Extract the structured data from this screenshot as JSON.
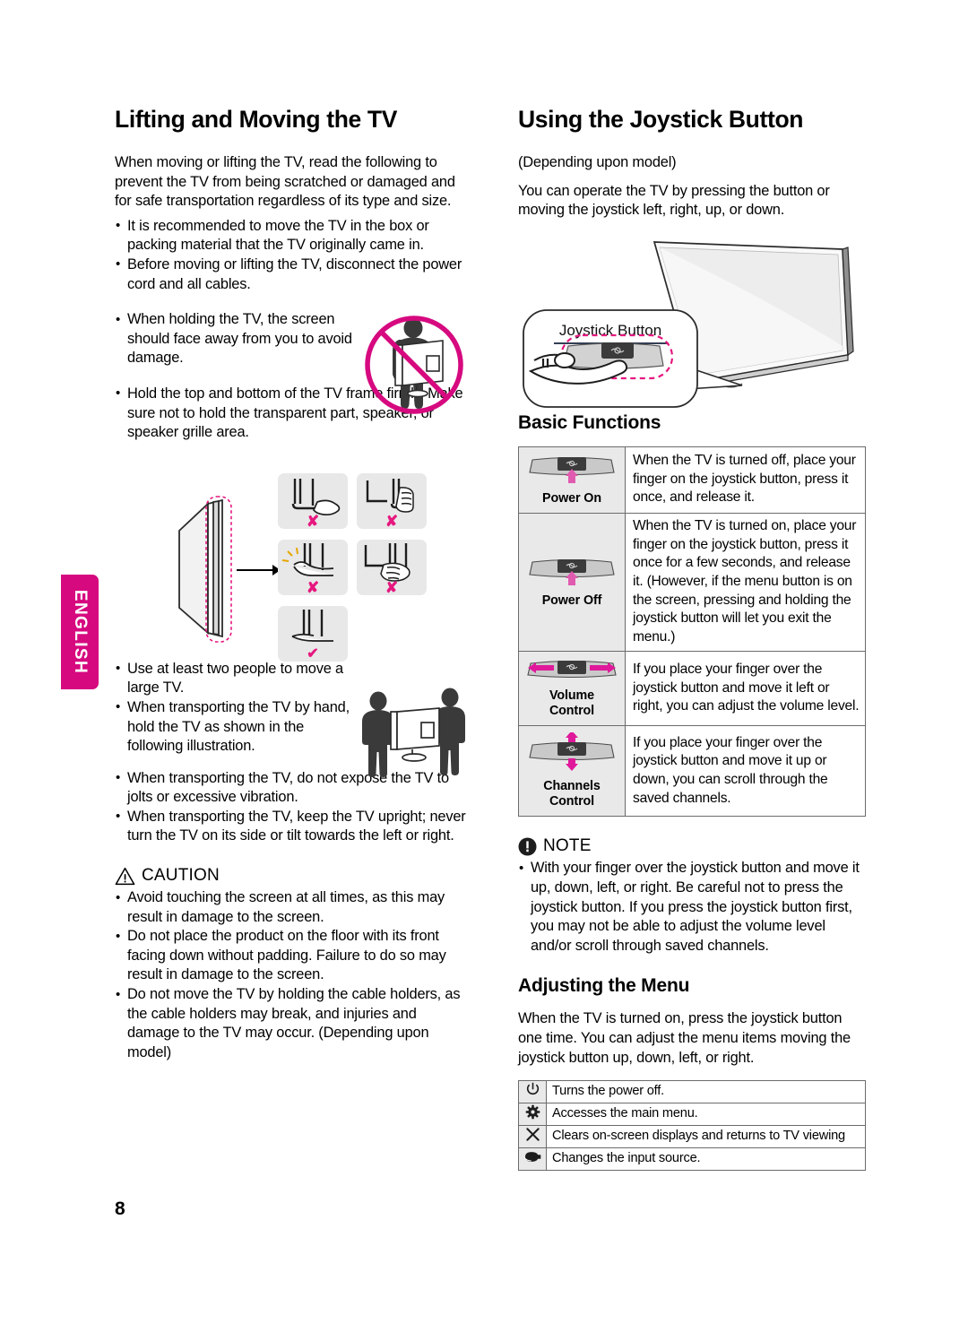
{
  "page": {
    "number": "8",
    "language_tab": "ENGLISH",
    "accent_color": "#d6097f",
    "table_border_color": "#6b6b6b",
    "icon_cell_bg": "#e9e9e9"
  },
  "left_column": {
    "heading": "Lifting and Moving the TV",
    "intro": "When moving or lifting the TV, read the following to prevent the TV from being scratched or damaged and for safe transportation regardless of its type and size.",
    "bullets_1": [
      "It is recommended to move the TV in the box or packing material that the TV originally came in.",
      "Before moving or lifting the TV, disconnect the power cord and all cables."
    ],
    "bullets_2": [
      "When holding the TV, the screen should face away from you to avoid damage."
    ],
    "bullets_3": [
      "Hold the top and bottom of the TV frame firmly. Make sure not to hold the transparent part, speaker, or speaker grille area."
    ],
    "bullets_4": [
      "Use at least two people to move a large TV.",
      "When transporting the TV by hand, hold the TV as shown in the following illustration."
    ],
    "bullets_5": [
      "When transporting the TV, do not expose the TV to jolts or excessive vibration.",
      "When transporting the TV, keep the TV upright; never turn the TV on its side or tilt towards the left or right."
    ],
    "caution": {
      "title": "CAUTION",
      "icon": "warning-triangle-icon",
      "bullets": [
        "Avoid touching the screen at all times, as this may result in damage to the screen.",
        "Do not place the product on the floor with its front facing down without padding. Failure to do so may result in damage to the screen.",
        "Do not move the TV by holding the cable holders, as the cable holders may break, and injuries and damage to the TV may occur. (Depending upon model)"
      ]
    },
    "figures": {
      "no_carry": {
        "name": "prohibited-carry-illustration",
        "mark": "prohibition-slash"
      },
      "grip_tiles": {
        "name": "tv-edge-grip-illustration",
        "marks": [
          "✘",
          "✘",
          "✘",
          "✘",
          "✔"
        ]
      },
      "two_people": {
        "name": "two-people-carrying-tv-illustration"
      }
    }
  },
  "right_column": {
    "heading": "Using the Joystick Button",
    "depending": "(Depending upon model)",
    "intro": "You can operate the TV by pressing the button or moving the joystick left, right, up, or down.",
    "callout_label": "Joystick Button",
    "basic_functions": {
      "heading": "Basic Functions",
      "rows": [
        {
          "label": "Power On",
          "icon": "joystick-press-up-icon",
          "arrow": "up",
          "description": "When the TV is turned off, place your finger on the joystick button, press it once, and release it."
        },
        {
          "label": "Power Off",
          "icon": "joystick-press-up-icon",
          "arrow": "up",
          "description": "When the TV is turned on, place your finger on the joystick button, press it once for a few seconds, and release it. (However, if the menu button is on the screen, pressing and holding the joystick button will let you exit the menu.)"
        },
        {
          "label": "Volume\nControl",
          "label_line1": "Volume",
          "label_line2": "Control",
          "icon": "joystick-left-right-icon",
          "arrow": "left-right",
          "description": "If you place your finger over the joystick button and move it left or right, you can adjust the volume level."
        },
        {
          "label_line1": "Channels",
          "label_line2": "Control",
          "icon": "joystick-up-down-icon",
          "arrow": "up-down",
          "description": "If you place your finger over the joystick button and move it up or down, you can scroll through the saved channels."
        }
      ]
    },
    "note": {
      "title": "NOTE",
      "icon": "note-exclamation-icon",
      "bullets": [
        "With your finger over the joystick button and move it up, down, left, or right. Be careful not to press the joystick button. If you press the joystick button first, you may not be able to adjust the volume level and/or scroll through saved channels."
      ]
    },
    "adjusting_menu": {
      "heading": "Adjusting the Menu",
      "intro": "When the TV is turned on, press the joystick button one time. You can adjust the menu items moving the joystick button up, down, left, or right.",
      "rows": [
        {
          "icon": "power-icon",
          "text": "Turns the power off."
        },
        {
          "icon": "gear-icon",
          "text": "Accesses the main menu."
        },
        {
          "icon": "close-x-icon",
          "text": "Clears on-screen displays and returns to TV viewing"
        },
        {
          "icon": "input-source-icon",
          "text": "Changes the input source."
        }
      ]
    }
  }
}
